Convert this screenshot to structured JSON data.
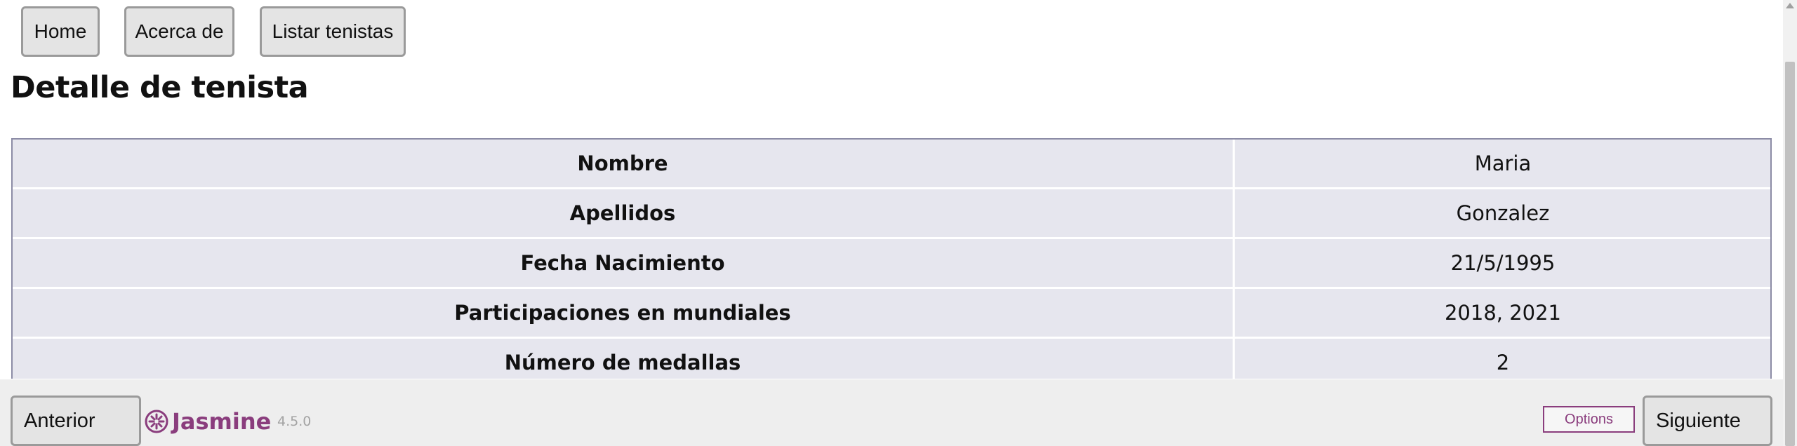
{
  "nav": {
    "items": [
      {
        "label": "Home"
      },
      {
        "label": "Acerca de"
      },
      {
        "label": "Listar tenistas"
      }
    ]
  },
  "page": {
    "title": "Detalle de tenista"
  },
  "detail": {
    "rows": [
      {
        "key": "Nombre",
        "value": "Maria"
      },
      {
        "key": "Apellidos",
        "value": "Gonzalez"
      },
      {
        "key": "Fecha Nacimiento",
        "value": "21/5/1995"
      },
      {
        "key": "Participaciones en mundiales",
        "value": "2018, 2021"
      },
      {
        "key": "Número de medallas",
        "value": "2"
      }
    ]
  },
  "footer": {
    "prev_label": "Anterior",
    "next_label": "Siguiente",
    "brand": "Jasmine",
    "brand_icon": "jasmine-flower-icon",
    "version": "4.5.0",
    "options_label": "Options",
    "brand_color": "#8a3d7d"
  }
}
